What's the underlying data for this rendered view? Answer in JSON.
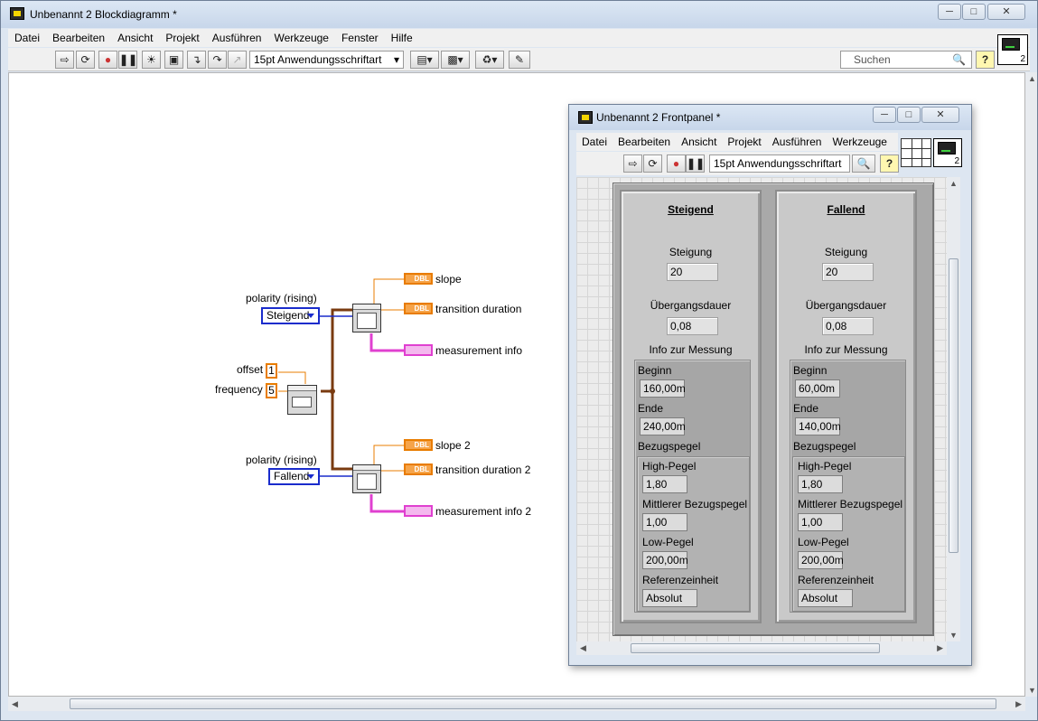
{
  "main_window": {
    "title": "Unbenannt 2 Blockdiagramm *",
    "menu": [
      "Datei",
      "Bearbeiten",
      "Ansicht",
      "Projekt",
      "Ausführen",
      "Werkzeuge",
      "Fenster",
      "Hilfe"
    ],
    "font_selector": "15pt Anwendungsschriftart",
    "search_placeholder": "Suchen",
    "help_label": "?",
    "vi_icon_number": "2"
  },
  "block_diagram": {
    "polarity_label_1": "polarity (rising)",
    "polarity_value_1": "Steigend",
    "polarity_label_2": "polarity (rising)",
    "polarity_value_2": "Fallend",
    "offset_label": "offset",
    "offset_value": "1",
    "frequency_label": "frequency",
    "frequency_value": "5",
    "dbl_tag": "DBL",
    "outputs_1": [
      "slope",
      "transition duration",
      "measurement info"
    ],
    "outputs_2": [
      "slope 2",
      "transition duration 2",
      "measurement info 2"
    ]
  },
  "front_panel": {
    "title": "Unbenannt 2 Frontpanel *",
    "menu": [
      "Datei",
      "Bearbeiten",
      "Ansicht",
      "Projekt",
      "Ausführen",
      "Werkzeuge"
    ],
    "font_selector": "15pt Anwendungsschriftart",
    "help_label": "?",
    "vi_icon_number": "2",
    "labels": {
      "steigung": "Steigung",
      "uebergangsdauer": "Übergangsdauer",
      "info": "Info zur Messung",
      "beginn": "Beginn",
      "ende": "Ende",
      "bezugspegel": "Bezugspegel",
      "high": "High-Pegel",
      "mittlerer": "Mittlerer Bezugspegel",
      "low": "Low-Pegel",
      "referenzeinheit": "Referenzeinheit"
    },
    "clusters": [
      {
        "title": "Steigend",
        "steigung": "20",
        "uebergangsdauer": "0,08",
        "beginn": "160,00m",
        "ende": "240,00m",
        "high": "1,80",
        "mittlerer": "1,00",
        "low": "200,00m",
        "referenzeinheit": "Absolut"
      },
      {
        "title": "Fallend",
        "steigung": "20",
        "uebergangsdauer": "0,08",
        "beginn": "60,00m",
        "ende": "140,00m",
        "high": "1,80",
        "mittlerer": "1,00",
        "low": "200,00m",
        "referenzeinheit": "Absolut"
      }
    ]
  },
  "colors": {
    "enum_blue": "#1a2ccc",
    "dbl_orange": "#e87c00",
    "cluster_pink": "#e040d0",
    "wire_brown": "#7a3b10"
  }
}
